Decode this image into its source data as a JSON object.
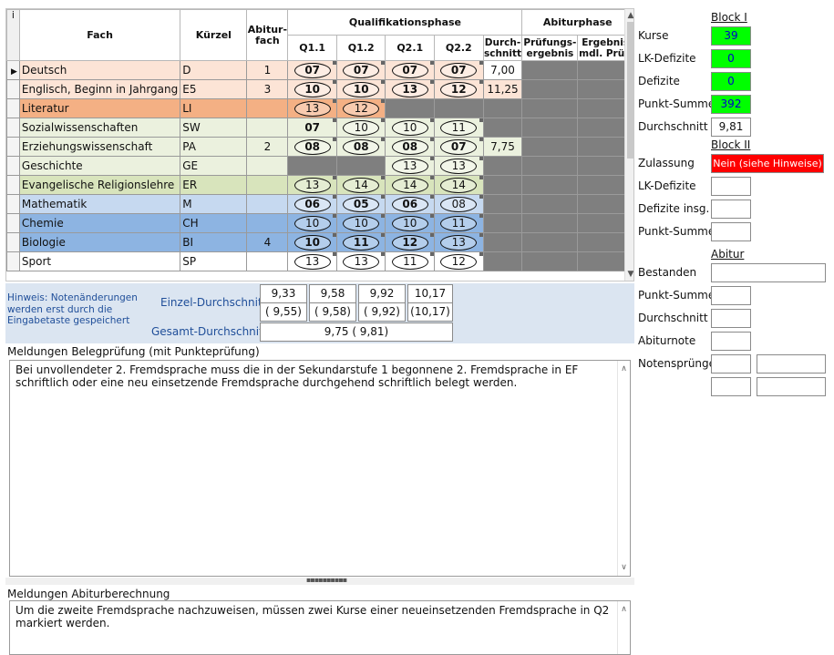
{
  "colors": {
    "deutsch": "#fce4d6",
    "literatur": "#f4b084",
    "arts": "#e2efda",
    "social": "#ebf1de",
    "math": "#c6d9f0",
    "science": "#8db4e2",
    "grey": "#808080",
    "accent_green": "#00ff00",
    "accent_red": "#ff0000",
    "hint_blue": "#1f4e99"
  },
  "grid": {
    "corner": "i",
    "headers": {
      "fach": "Fach",
      "kuerzel": "Kürzel",
      "abiturfach": "Abitur-fach",
      "qualifikationsphase": "Qualifikationsphase",
      "abiturphase": "Abiturphase",
      "q11": "Q1.1",
      "q12": "Q1.2",
      "q21": "Q2.1",
      "q22": "Q2.2",
      "durchschnitt": "Durch-schnitt",
      "pruefung": "Prüfungs-ergebnis",
      "muendlich": "Ergebnis mdl. Prüf."
    },
    "rows": [
      {
        "fach": "Deutsch",
        "kuerzel": "D",
        "abi": "1",
        "color": "#fce4d6",
        "selected": true,
        "g": [
          {
            "v": "07",
            "s": "ob"
          },
          {
            "v": "07",
            "s": "ob"
          },
          {
            "v": "07",
            "s": "ob"
          },
          {
            "v": "07",
            "s": "ob"
          }
        ],
        "avg": "7,00",
        "avgbg": "#ffffff",
        "pr": "grey",
        "md": "grey"
      },
      {
        "fach": "Englisch, Beginn in Jahrgang",
        "kuerzel": "E5",
        "abi": "3",
        "color": "#fce4d6",
        "g": [
          {
            "v": "10",
            "s": "ob"
          },
          {
            "v": "10",
            "s": "ob"
          },
          {
            "v": "13",
            "s": "ob"
          },
          {
            "v": "12",
            "s": "ob"
          }
        ],
        "avg": "11,25",
        "avgbg": "#fce4d6",
        "pr": "grey",
        "md": "grey"
      },
      {
        "fach": "Literatur",
        "kuerzel": "LI",
        "abi": "",
        "color": "#f4b084",
        "g": [
          {
            "v": "13",
            "s": "o"
          },
          {
            "v": "12",
            "s": "o"
          },
          {
            "v": "",
            "s": "grey"
          },
          {
            "v": "",
            "s": "grey"
          }
        ],
        "avg": "",
        "avgbg": "grey",
        "pr": "grey",
        "md": "grey"
      },
      {
        "fach": "Sozialwissenschaften",
        "kuerzel": "SW",
        "abi": "",
        "color": "#ebf1de",
        "g": [
          {
            "v": "07",
            "s": "b"
          },
          {
            "v": "10",
            "s": "o"
          },
          {
            "v": "10",
            "s": "o"
          },
          {
            "v": "11",
            "s": "o"
          }
        ],
        "avg": "",
        "avgbg": "grey",
        "pr": "grey",
        "md": "grey"
      },
      {
        "fach": "Erziehungswissenschaft",
        "kuerzel": "PA",
        "abi": "2",
        "color": "#ebf1de",
        "g": [
          {
            "v": "08",
            "s": "ob"
          },
          {
            "v": "08",
            "s": "ob"
          },
          {
            "v": "08",
            "s": "ob"
          },
          {
            "v": "07",
            "s": "ob"
          }
        ],
        "avg": "7,75",
        "avgbg": "#ebf1de",
        "pr": "grey",
        "md": "grey"
      },
      {
        "fach": "Geschichte",
        "kuerzel": "GE",
        "abi": "",
        "color": "#ebf1de",
        "g": [
          {
            "v": "",
            "s": "grey"
          },
          {
            "v": "",
            "s": "grey"
          },
          {
            "v": "13",
            "s": "o"
          },
          {
            "v": "13",
            "s": "o"
          }
        ],
        "avg": "",
        "avgbg": "grey",
        "pr": "grey",
        "md": "grey"
      },
      {
        "fach": "Evangelische Religionslehre",
        "kuerzel": "ER",
        "abi": "",
        "color": "#d8e4bc",
        "g": [
          {
            "v": "13",
            "s": "o"
          },
          {
            "v": "14",
            "s": "o"
          },
          {
            "v": "14",
            "s": "o"
          },
          {
            "v": "14",
            "s": "o"
          }
        ],
        "avg": "",
        "avgbg": "grey",
        "pr": "grey",
        "md": "grey"
      },
      {
        "fach": "Mathematik",
        "kuerzel": "M",
        "abi": "",
        "color": "#c6d9f0",
        "g": [
          {
            "v": "06",
            "s": "ob"
          },
          {
            "v": "05",
            "s": "ob"
          },
          {
            "v": "06",
            "s": "ob"
          },
          {
            "v": "08",
            "s": "o"
          }
        ],
        "avg": "",
        "avgbg": "grey",
        "pr": "grey",
        "md": "grey"
      },
      {
        "fach": "Chemie",
        "kuerzel": "CH",
        "abi": "",
        "color": "#8db4e2",
        "g": [
          {
            "v": "10",
            "s": "o"
          },
          {
            "v": "10",
            "s": "o"
          },
          {
            "v": "10",
            "s": "o"
          },
          {
            "v": "11",
            "s": "o"
          }
        ],
        "avg": "",
        "avgbg": "grey",
        "pr": "grey",
        "md": "grey"
      },
      {
        "fach": "Biologie",
        "kuerzel": "BI",
        "abi": "4",
        "color": "#8db4e2",
        "g": [
          {
            "v": "10",
            "s": "ob"
          },
          {
            "v": "11",
            "s": "ob"
          },
          {
            "v": "12",
            "s": "ob"
          },
          {
            "v": "13",
            "s": "o"
          }
        ],
        "avg": "",
        "avgbg": "grey",
        "pr": "grey",
        "md": "grey"
      },
      {
        "fach": "Sport",
        "kuerzel": "SP",
        "abi": "",
        "color": "#ffffff",
        "g": [
          {
            "v": "13",
            "s": "o"
          },
          {
            "v": "13",
            "s": "o"
          },
          {
            "v": "11",
            "s": "o"
          },
          {
            "v": "12",
            "s": "o"
          }
        ],
        "avg": "",
        "avgbg": "grey",
        "pr": "grey",
        "md": "grey"
      }
    ]
  },
  "averages": {
    "hint": "Hinweis: Notenänderungen werden erst durch die Eingabetaste  gespeichert",
    "einzel_label": "Einzel-Durchschnitt",
    "gesamt_label": "Gesamt-Durchschnitt",
    "einzel": [
      "9,33",
      "9,58",
      "9,92",
      "10,17"
    ],
    "einzel_alt": [
      "( 9,55)",
      "( 9,58)",
      "( 9,92)",
      "(10,17)"
    ],
    "gesamt": "9,75 ( 9,81)"
  },
  "belegpruefung": {
    "title": "Meldungen Belegprüfung (mit Punkteprüfung)",
    "text": "Bei unvollendeter 2. Fremdsprache muss die in der Sekundarstufe 1 begonnene 2. Fremdsprache in EF schriftlich oder eine neu einsetzende Fremdsprache durchgehend schriftlich belegt werden."
  },
  "abiturberechnung": {
    "title": "Meldungen Abiturberechnung",
    "text": "Um die zweite Fremdsprache nachzuweisen, müssen zwei Kurse einer neueinsetzenden Fremdsprache in Q2 markiert werden."
  },
  "right": {
    "block1": {
      "title": "Block I",
      "kurse_label": "Kurse",
      "kurse": "39",
      "lk_label": "LK-Defizite",
      "lk": "0",
      "def_label": "Defizite",
      "def": "0",
      "punkt_label": "Punkt-Summe",
      "punkt": "392",
      "schnitt_label": "Durchschnitt",
      "schnitt": "9,81"
    },
    "block2": {
      "title": "Block II",
      "zul_label": "Zulassung",
      "zul": "Nein (siehe Hinweise)",
      "lk_label": "LK-Defizite",
      "lk": "",
      "def_label": "Defizite insg.",
      "def": "",
      "punkt_label": "Punkt-Summe",
      "punkt": ""
    },
    "abitur": {
      "title": "Abitur",
      "best_label": "Bestanden",
      "best": "",
      "punkt_label": "Punkt-Summe",
      "punkt": "",
      "schnitt_label": "Durchschnitt",
      "schnitt": "",
      "note_label": "Abiturnote",
      "note": "",
      "spr_label": "Notensprünge",
      "spr": [
        "",
        "",
        "",
        ""
      ]
    }
  }
}
